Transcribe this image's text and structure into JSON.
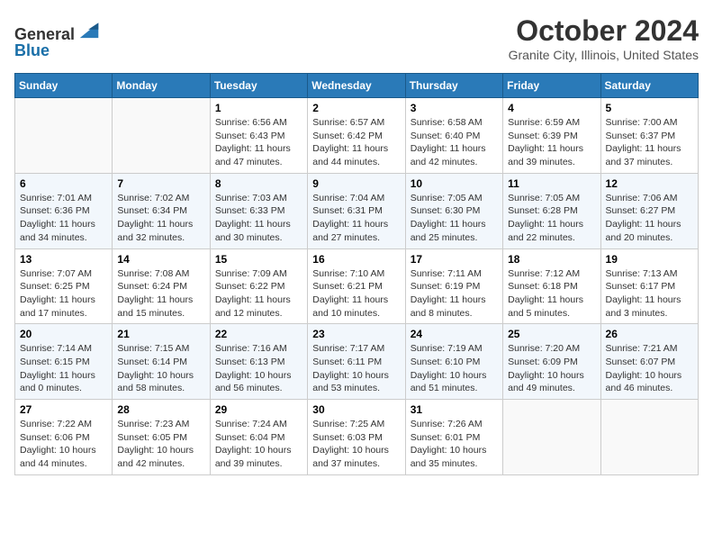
{
  "header": {
    "logo_line1": "General",
    "logo_line2": "Blue",
    "month": "October 2024",
    "location": "Granite City, Illinois, United States"
  },
  "days_of_week": [
    "Sunday",
    "Monday",
    "Tuesday",
    "Wednesday",
    "Thursday",
    "Friday",
    "Saturday"
  ],
  "weeks": [
    [
      {
        "day": "",
        "info": ""
      },
      {
        "day": "",
        "info": ""
      },
      {
        "day": "1",
        "info": "Sunrise: 6:56 AM\nSunset: 6:43 PM\nDaylight: 11 hours and 47 minutes."
      },
      {
        "day": "2",
        "info": "Sunrise: 6:57 AM\nSunset: 6:42 PM\nDaylight: 11 hours and 44 minutes."
      },
      {
        "day": "3",
        "info": "Sunrise: 6:58 AM\nSunset: 6:40 PM\nDaylight: 11 hours and 42 minutes."
      },
      {
        "day": "4",
        "info": "Sunrise: 6:59 AM\nSunset: 6:39 PM\nDaylight: 11 hours and 39 minutes."
      },
      {
        "day": "5",
        "info": "Sunrise: 7:00 AM\nSunset: 6:37 PM\nDaylight: 11 hours and 37 minutes."
      }
    ],
    [
      {
        "day": "6",
        "info": "Sunrise: 7:01 AM\nSunset: 6:36 PM\nDaylight: 11 hours and 34 minutes."
      },
      {
        "day": "7",
        "info": "Sunrise: 7:02 AM\nSunset: 6:34 PM\nDaylight: 11 hours and 32 minutes."
      },
      {
        "day": "8",
        "info": "Sunrise: 7:03 AM\nSunset: 6:33 PM\nDaylight: 11 hours and 30 minutes."
      },
      {
        "day": "9",
        "info": "Sunrise: 7:04 AM\nSunset: 6:31 PM\nDaylight: 11 hours and 27 minutes."
      },
      {
        "day": "10",
        "info": "Sunrise: 7:05 AM\nSunset: 6:30 PM\nDaylight: 11 hours and 25 minutes."
      },
      {
        "day": "11",
        "info": "Sunrise: 7:05 AM\nSunset: 6:28 PM\nDaylight: 11 hours and 22 minutes."
      },
      {
        "day": "12",
        "info": "Sunrise: 7:06 AM\nSunset: 6:27 PM\nDaylight: 11 hours and 20 minutes."
      }
    ],
    [
      {
        "day": "13",
        "info": "Sunrise: 7:07 AM\nSunset: 6:25 PM\nDaylight: 11 hours and 17 minutes."
      },
      {
        "day": "14",
        "info": "Sunrise: 7:08 AM\nSunset: 6:24 PM\nDaylight: 11 hours and 15 minutes."
      },
      {
        "day": "15",
        "info": "Sunrise: 7:09 AM\nSunset: 6:22 PM\nDaylight: 11 hours and 12 minutes."
      },
      {
        "day": "16",
        "info": "Sunrise: 7:10 AM\nSunset: 6:21 PM\nDaylight: 11 hours and 10 minutes."
      },
      {
        "day": "17",
        "info": "Sunrise: 7:11 AM\nSunset: 6:19 PM\nDaylight: 11 hours and 8 minutes."
      },
      {
        "day": "18",
        "info": "Sunrise: 7:12 AM\nSunset: 6:18 PM\nDaylight: 11 hours and 5 minutes."
      },
      {
        "day": "19",
        "info": "Sunrise: 7:13 AM\nSunset: 6:17 PM\nDaylight: 11 hours and 3 minutes."
      }
    ],
    [
      {
        "day": "20",
        "info": "Sunrise: 7:14 AM\nSunset: 6:15 PM\nDaylight: 11 hours and 0 minutes."
      },
      {
        "day": "21",
        "info": "Sunrise: 7:15 AM\nSunset: 6:14 PM\nDaylight: 10 hours and 58 minutes."
      },
      {
        "day": "22",
        "info": "Sunrise: 7:16 AM\nSunset: 6:13 PM\nDaylight: 10 hours and 56 minutes."
      },
      {
        "day": "23",
        "info": "Sunrise: 7:17 AM\nSunset: 6:11 PM\nDaylight: 10 hours and 53 minutes."
      },
      {
        "day": "24",
        "info": "Sunrise: 7:19 AM\nSunset: 6:10 PM\nDaylight: 10 hours and 51 minutes."
      },
      {
        "day": "25",
        "info": "Sunrise: 7:20 AM\nSunset: 6:09 PM\nDaylight: 10 hours and 49 minutes."
      },
      {
        "day": "26",
        "info": "Sunrise: 7:21 AM\nSunset: 6:07 PM\nDaylight: 10 hours and 46 minutes."
      }
    ],
    [
      {
        "day": "27",
        "info": "Sunrise: 7:22 AM\nSunset: 6:06 PM\nDaylight: 10 hours and 44 minutes."
      },
      {
        "day": "28",
        "info": "Sunrise: 7:23 AM\nSunset: 6:05 PM\nDaylight: 10 hours and 42 minutes."
      },
      {
        "day": "29",
        "info": "Sunrise: 7:24 AM\nSunset: 6:04 PM\nDaylight: 10 hours and 39 minutes."
      },
      {
        "day": "30",
        "info": "Sunrise: 7:25 AM\nSunset: 6:03 PM\nDaylight: 10 hours and 37 minutes."
      },
      {
        "day": "31",
        "info": "Sunrise: 7:26 AM\nSunset: 6:01 PM\nDaylight: 10 hours and 35 minutes."
      },
      {
        "day": "",
        "info": ""
      },
      {
        "day": "",
        "info": ""
      }
    ]
  ]
}
